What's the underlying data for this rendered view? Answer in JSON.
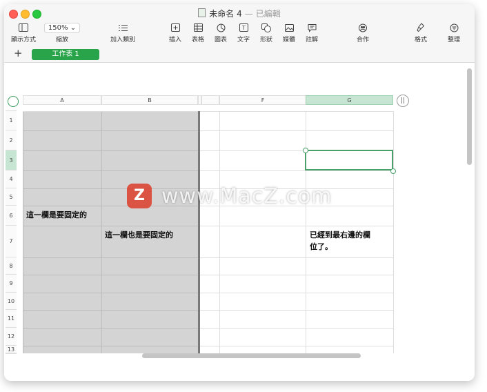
{
  "window": {
    "title": "未命名 4",
    "separator": "—",
    "status": "已編輯"
  },
  "toolbar": {
    "view": {
      "label": "顯示方式",
      "icon": "sidebar-icon"
    },
    "zoom": {
      "value": "150%",
      "label": "縮放",
      "icon": "chevron-down-icon"
    },
    "add_category": {
      "label": "加入類別",
      "icon": "list-icon"
    },
    "insert": {
      "label": "插入",
      "icon": "plus-box-icon"
    },
    "table": {
      "label": "表格",
      "icon": "table-icon"
    },
    "chart": {
      "label": "圖表",
      "icon": "chart-icon"
    },
    "text": {
      "label": "文字",
      "icon": "text-icon"
    },
    "shape": {
      "label": "形狀",
      "icon": "shape-icon"
    },
    "media": {
      "label": "媒體",
      "icon": "image-icon"
    },
    "comment": {
      "label": "註解",
      "icon": "comment-icon"
    },
    "collaborate": {
      "label": "合作",
      "icon": "collaborate-icon"
    },
    "format": {
      "label": "格式",
      "icon": "paintbrush-icon"
    },
    "organize": {
      "label": "整理",
      "icon": "organize-icon"
    }
  },
  "sheets": {
    "add_label": "+",
    "tabs": [
      {
        "label": "工作表 1",
        "active": true
      }
    ]
  },
  "spreadsheet": {
    "columns": [
      "A",
      "B",
      "F",
      "G"
    ],
    "selected_column": "G",
    "rows": [
      "1",
      "2",
      "3",
      "4",
      "5",
      "6",
      "7",
      "8",
      "9",
      "10",
      "11",
      "12",
      "13"
    ],
    "selected_row": "3",
    "freeze_button": "||",
    "cells": {
      "A6": "這一欄是要固定的",
      "B7": "這一欄也是要固定的",
      "G7_line1": "已經到最右邊的欄",
      "G7_line2": "位了。"
    }
  },
  "watermark": {
    "logo": "Z",
    "text": "www.MacZ.com"
  },
  "colors": {
    "accent": "#2aa44a",
    "selection": "#4aa06a",
    "frozen_region": "#d4d4d4",
    "header_selected": "#c6e6d3"
  }
}
